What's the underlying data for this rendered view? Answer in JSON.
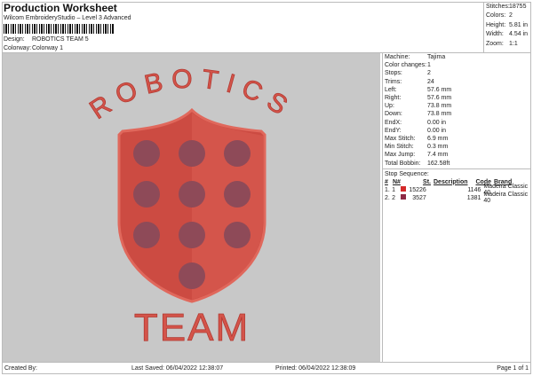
{
  "header": {
    "title": "Production Worksheet",
    "subtitle": "Wilcom EmbroideryStudio – Level 3 Advanced",
    "design_label": "Design:",
    "design_value": "ROBOTICS TEAM 5",
    "colorway_label": "Colorway:",
    "colorway_value": "Colorway 1"
  },
  "stats": [
    {
      "k": "Stitches:",
      "v": "18755"
    },
    {
      "k": "Colors:",
      "v": "2"
    },
    {
      "k": "Height:",
      "v": "5.81 in"
    },
    {
      "k": "Width:",
      "v": "4.54 in"
    },
    {
      "k": "Zoom:",
      "v": "1:1"
    }
  ],
  "details": [
    {
      "k": "Machine:",
      "v": "Tajima"
    },
    {
      "k": "Color changes:",
      "v": "1"
    },
    {
      "k": "Stops:",
      "v": "2"
    },
    {
      "k": "Trims:",
      "v": "24"
    },
    {
      "k": "Left:",
      "v": "57.6 mm"
    },
    {
      "k": "Right:",
      "v": "57.6 mm"
    },
    {
      "k": "Up:",
      "v": "73.8 mm"
    },
    {
      "k": "Down:",
      "v": "73.8 mm"
    },
    {
      "k": "EndX:",
      "v": "0.00 in"
    },
    {
      "k": "EndY:",
      "v": "0.00 in"
    },
    {
      "k": "Max Stitch:",
      "v": "6.9 mm"
    },
    {
      "k": "Min Stitch:",
      "v": "0.3 mm"
    },
    {
      "k": "Max Jump:",
      "v": "7.4 mm"
    },
    {
      "k": "Total Bobbin:",
      "v": "162.58ft"
    }
  ],
  "stop_sequence": {
    "label": "Stop Sequence:",
    "headers": [
      "#",
      "N#",
      "St.",
      "Description",
      "Code",
      "Brand"
    ],
    "rows": [
      {
        "n": "1.",
        "nn": "1",
        "color": "#d42a2a",
        "st": "15226",
        "desc": "",
        "code": "1146",
        "brand": "Madeira Classic 40"
      },
      {
        "n": "2.",
        "nn": "2",
        "color": "#8e2a45",
        "st": "3527",
        "desc": "",
        "code": "1381",
        "brand": "Madeira Classic 40"
      }
    ]
  },
  "design": {
    "arc_text": "ROBOTICS",
    "bottom_text": "TEAM",
    "colors": {
      "main": "#d4544a",
      "dots": "#8e4a58",
      "background": "#c8c8c8"
    }
  },
  "footer": {
    "created_by": "Created By:",
    "last_saved": "Last Saved: 06/04/2022 12:38:07",
    "printed": "Printed: 06/04/2022 12:38:09",
    "page": "Page 1 of 1"
  }
}
